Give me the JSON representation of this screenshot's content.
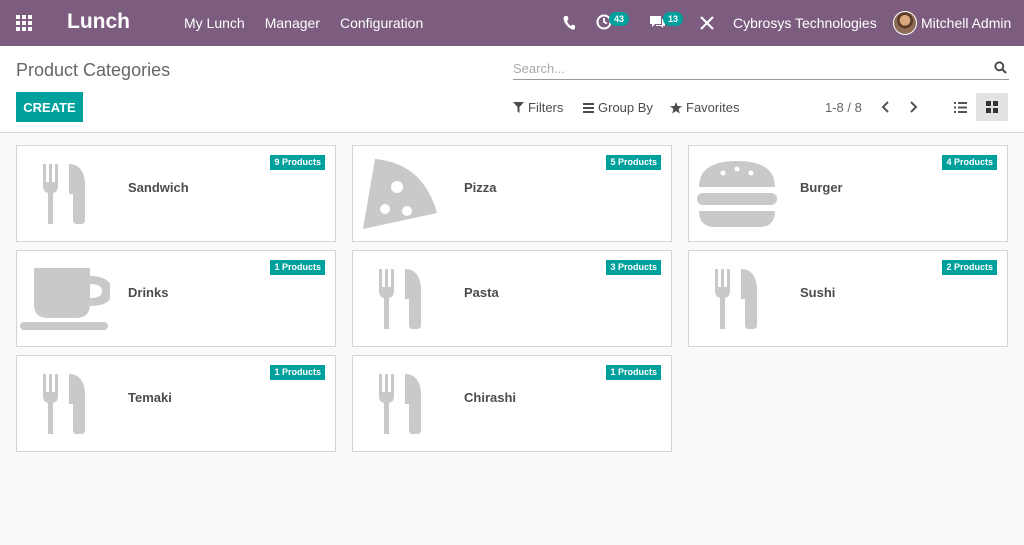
{
  "navbar": {
    "app_title": "Lunch",
    "menu": [
      "My Lunch",
      "Manager",
      "Configuration"
    ],
    "activity_count": "43",
    "message_count": "13",
    "company": "Cybrosys Technologies",
    "user": "Mitchell Admin"
  },
  "control": {
    "breadcrumb": "Product Categories",
    "search_placeholder": "Search...",
    "create_label": "CREATE",
    "filters_label": "Filters",
    "groupby_label": "Group By",
    "favorites_label": "Favorites",
    "pager": "1-8 / 8"
  },
  "categories": [
    {
      "name": "Sandwich",
      "count": "9 Products",
      "icon": "cutlery-icon"
    },
    {
      "name": "Pizza",
      "count": "5 Products",
      "icon": "pizza-icon"
    },
    {
      "name": "Burger",
      "count": "4 Products",
      "icon": "burger-icon"
    },
    {
      "name": "Drinks",
      "count": "1 Products",
      "icon": "coffee-icon"
    },
    {
      "name": "Pasta",
      "count": "3 Products",
      "icon": "cutlery-icon"
    },
    {
      "name": "Sushi",
      "count": "2 Products",
      "icon": "cutlery-icon"
    },
    {
      "name": "Temaki",
      "count": "1 Products",
      "icon": "cutlery-icon"
    },
    {
      "name": "Chirashi",
      "count": "1 Products",
      "icon": "cutlery-icon"
    }
  ],
  "colors": {
    "navbar": "#7c5c7f",
    "accent": "#00a09d",
    "icon_gray": "#c9c9c9"
  }
}
